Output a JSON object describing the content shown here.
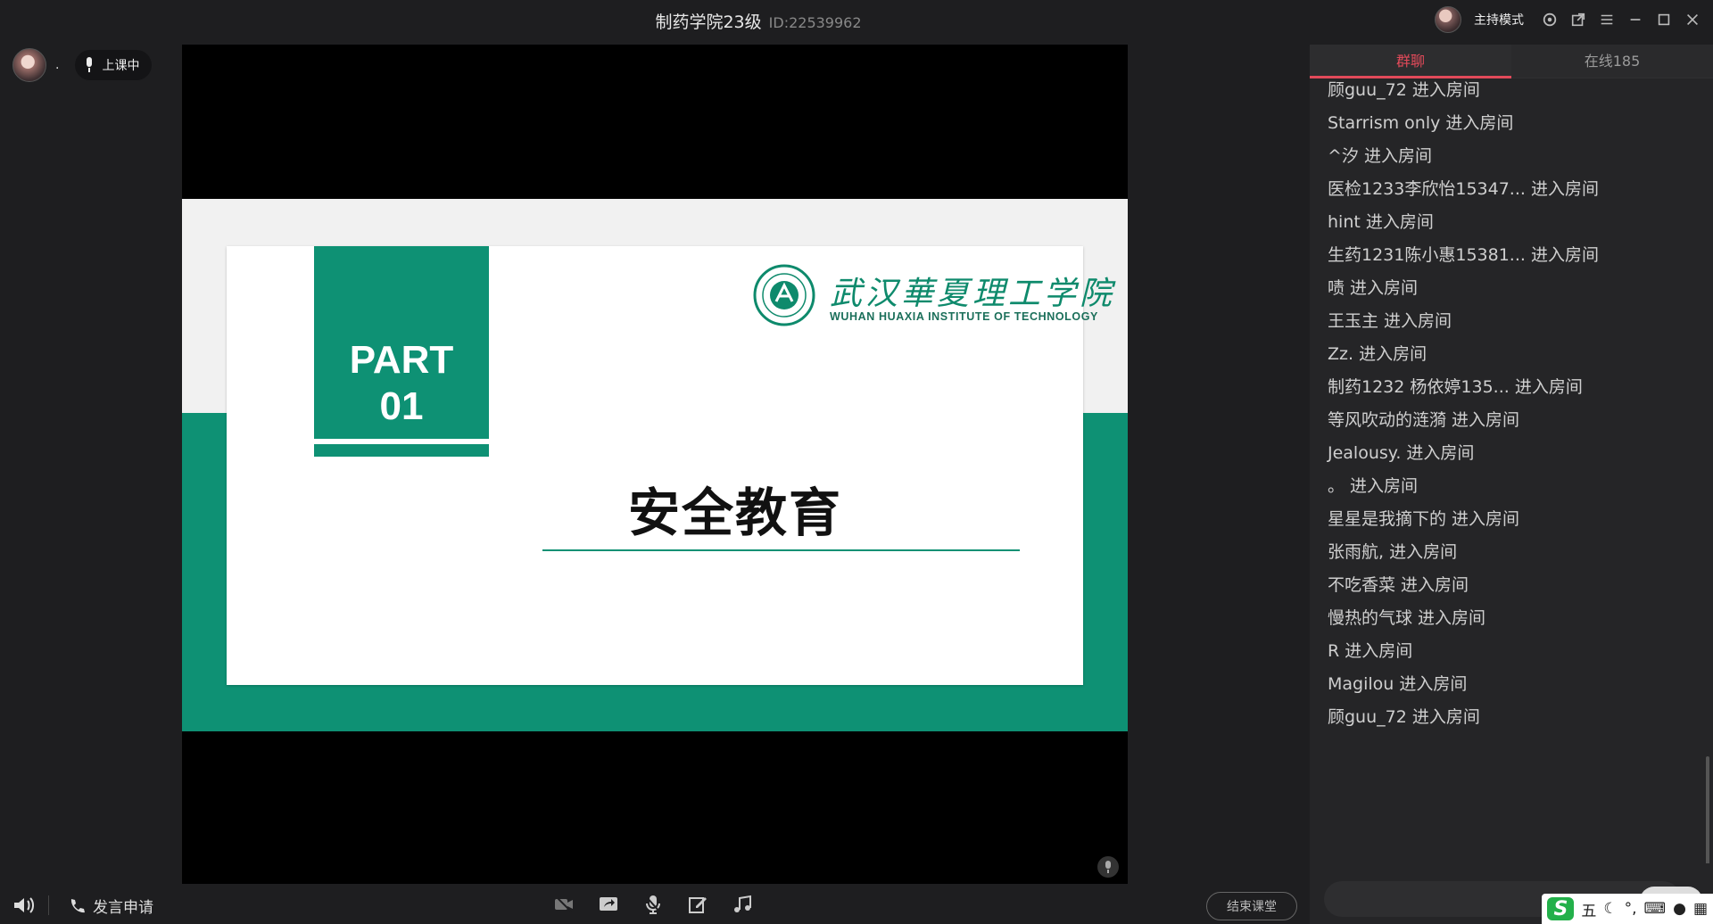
{
  "window": {
    "title": "制药学院23级",
    "room_id": "ID:22539962",
    "host_mode_label": "主持模式"
  },
  "status": {
    "user_label": ".",
    "class_state": "上课中"
  },
  "slide": {
    "part_word": "PART",
    "part_number": "01",
    "logo_cn": "武汉華夏理工学院",
    "logo_en": "WUHAN HUAXIA INSTITUTE OF TECHNOLOGY",
    "title": "安全教育"
  },
  "panel": {
    "tabs": [
      {
        "label": "群聊",
        "active": true
      },
      {
        "label": "在线185",
        "active": false
      }
    ],
    "messages": [
      "顾guu_72 进入房间",
      "Starrism only 进入房间",
      "^汐 进入房间",
      "医检1233李欣怡15347... 进入房间",
      "hint 进入房间",
      "生药1231陈小惠15381... 进入房间",
      "啧 进入房间",
      "王玉主 进入房间",
      "Zz. 进入房间",
      "制药1232 杨依婷135... 进入房间",
      "等风吹动的涟漪 进入房间",
      "Jealousy. 进入房间",
      "。 进入房间",
      "星星是我摘下的 进入房间",
      "张雨航, 进入房间",
      "不吃香菜 进入房间",
      "慢热的气球 进入房间",
      "R 进入房间",
      "Magilou 进入房间",
      "顾guu_72 进入房间"
    ]
  },
  "ime": {
    "mode": "五",
    "logo": "S"
  },
  "bottom": {
    "speak_request": "发言申请",
    "end_class": "结束课堂"
  },
  "colors": {
    "brand_green": "#0e9174",
    "accent_red": "#e24a5a",
    "background": "#1e1e20"
  }
}
